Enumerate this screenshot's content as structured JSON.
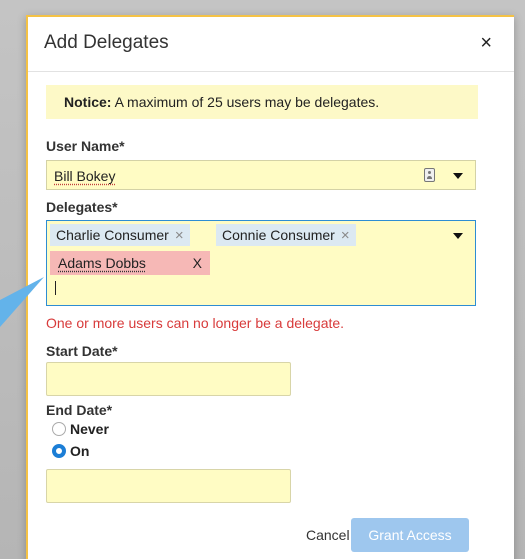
{
  "dialog": {
    "title": "Add Delegates",
    "close_glyph": "×"
  },
  "notice": {
    "label": "Notice:",
    "text": "A maximum of 25 users may be delegates."
  },
  "user_name": {
    "label": "User Name*",
    "value": "Bill Bokey"
  },
  "delegates": {
    "label": "Delegates*",
    "chips": [
      {
        "name": "Charlie Consumer",
        "remove_glyph": "×"
      },
      {
        "name": "Connie Consumer",
        "remove_glyph": "×"
      }
    ],
    "invalid_chip": {
      "name": "Adams Dobbs",
      "remove_glyph": "X"
    },
    "error": "One or more users can no longer be a delegate."
  },
  "start_date": {
    "label": "Start Date*",
    "value": ""
  },
  "end_date": {
    "label": "End Date*",
    "options": [
      {
        "label": "Never",
        "selected": false
      },
      {
        "label": "On",
        "selected": true
      }
    ],
    "value": ""
  },
  "footer": {
    "cancel_label": "Cancel",
    "grant_label": "Grant Access"
  },
  "colors": {
    "field_bg": "#fffcc4",
    "error_text": "#d83b3b",
    "chip_bg": "#dce9f2",
    "invalid_chip_bg": "#f6b8b6",
    "primary_disabled": "#9ec7ee",
    "callout": "#63b3ea"
  }
}
